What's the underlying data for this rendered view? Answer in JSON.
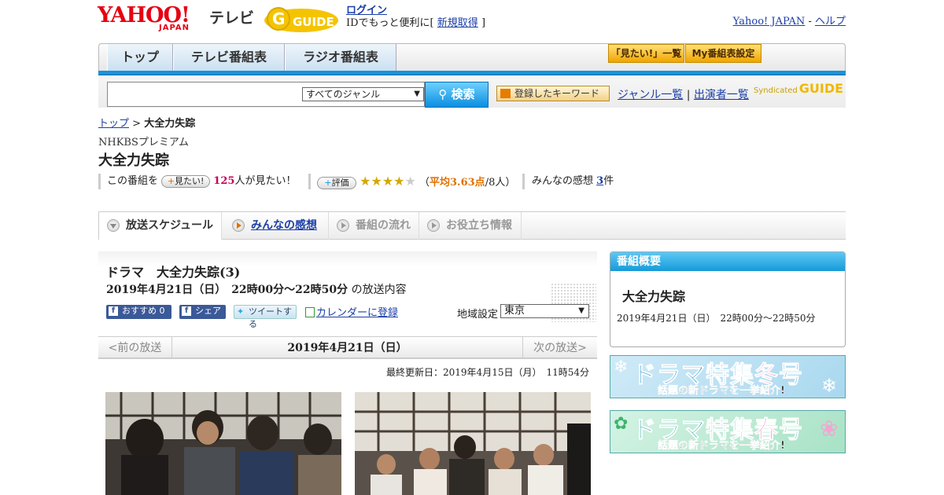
{
  "header": {
    "yahoo": "YAHOO!",
    "japan": "JAPAN",
    "tv": "テレビ",
    "gguide": "GUIDE",
    "login_label": "ログイン",
    "login_text": "IDでもっと便利に[",
    "register_label": "新規取得",
    "login_text_end": "]",
    "yahoo_japan_link": "Yahoo! JAPAN",
    "separator": "-",
    "help_link": "ヘルプ"
  },
  "nav": {
    "tabs": [
      "トップ",
      "テレビ番組表",
      "ラジオ番組表"
    ],
    "mitai_list": "「見たい!」一覧",
    "my_table": "My番組表設定"
  },
  "search": {
    "genre_selected": "すべてのジャンル",
    "search_button": "検索",
    "keyword_button": "登録したキーワード",
    "genre_list": "ジャンル一覧",
    "pipe": "|",
    "performer_list": "出演者一覧",
    "syndicated": "Syndicated",
    "gguide": "GUIDE"
  },
  "breadcrumb": {
    "top": "トップ",
    "sep": ">",
    "current": "大全力失踪"
  },
  "program": {
    "channel": "NHKBSプレミアム",
    "title": "大全力失踪",
    "mitai_prefix": "この番組を",
    "mitai_button": "見たい!",
    "mitai_count": "125",
    "mitai_suffix": "人が見たい！",
    "rating_button": "評価",
    "rating_value": 3.63,
    "rating_open": "（",
    "rating_avg": "平均3.63点",
    "rating_people": "/8人）",
    "impressions_label": "みんなの感想",
    "impressions_count": "3",
    "impressions_unit": "件"
  },
  "tabs": [
    "放送スケジュール",
    "みんなの感想",
    "番組の流れ",
    "お役立ち情報"
  ],
  "broadcast": {
    "episode_title": "ドラマ　大全力失踪(3)",
    "time": "2019年4月21日（日）　22時00分～22時50分",
    "time_suffix": "の放送内容",
    "recommend": "おすすめ 0",
    "share": "シェア",
    "tweet": "ツイートする",
    "calendar": "カレンダーに登録",
    "region_label": "地域設定",
    "region_value": "東京",
    "prev": "<前の放送",
    "date": "2019年4月21日（日）",
    "next": "次の放送>",
    "updated": "最終更新日：2019年4月15日（月）　11時54分"
  },
  "sidebar": {
    "head": "番組概要",
    "title": "大全力失踪",
    "time": "2019年4月21日（日）　22時00分～22時50分",
    "banner_winter": {
      "main_pre": "ドラマ特集",
      "main_hl": "冬",
      "main_post": "号",
      "sub_pre": "話題の",
      "sub_hl": "新",
      "sub_post": "ドラマを一挙紹介!"
    },
    "banner_spring": {
      "main_pre": "ドラマ特集",
      "main_hl": "春",
      "main_post": "号",
      "sub_pre": "話題の",
      "sub_hl": "新",
      "sub_post": "ドラマを一挙紹介!"
    }
  },
  "colors": {
    "accent": "#1992d9",
    "yahoo_red": "#e60012",
    "link": "#1b3ea6",
    "star": "#d4a800",
    "pink": "#e2168a"
  },
  "icons": [
    "search-icon",
    "facebook-icon",
    "twitter-icon",
    "calendar-icon",
    "play-icon",
    "star-icon"
  ]
}
